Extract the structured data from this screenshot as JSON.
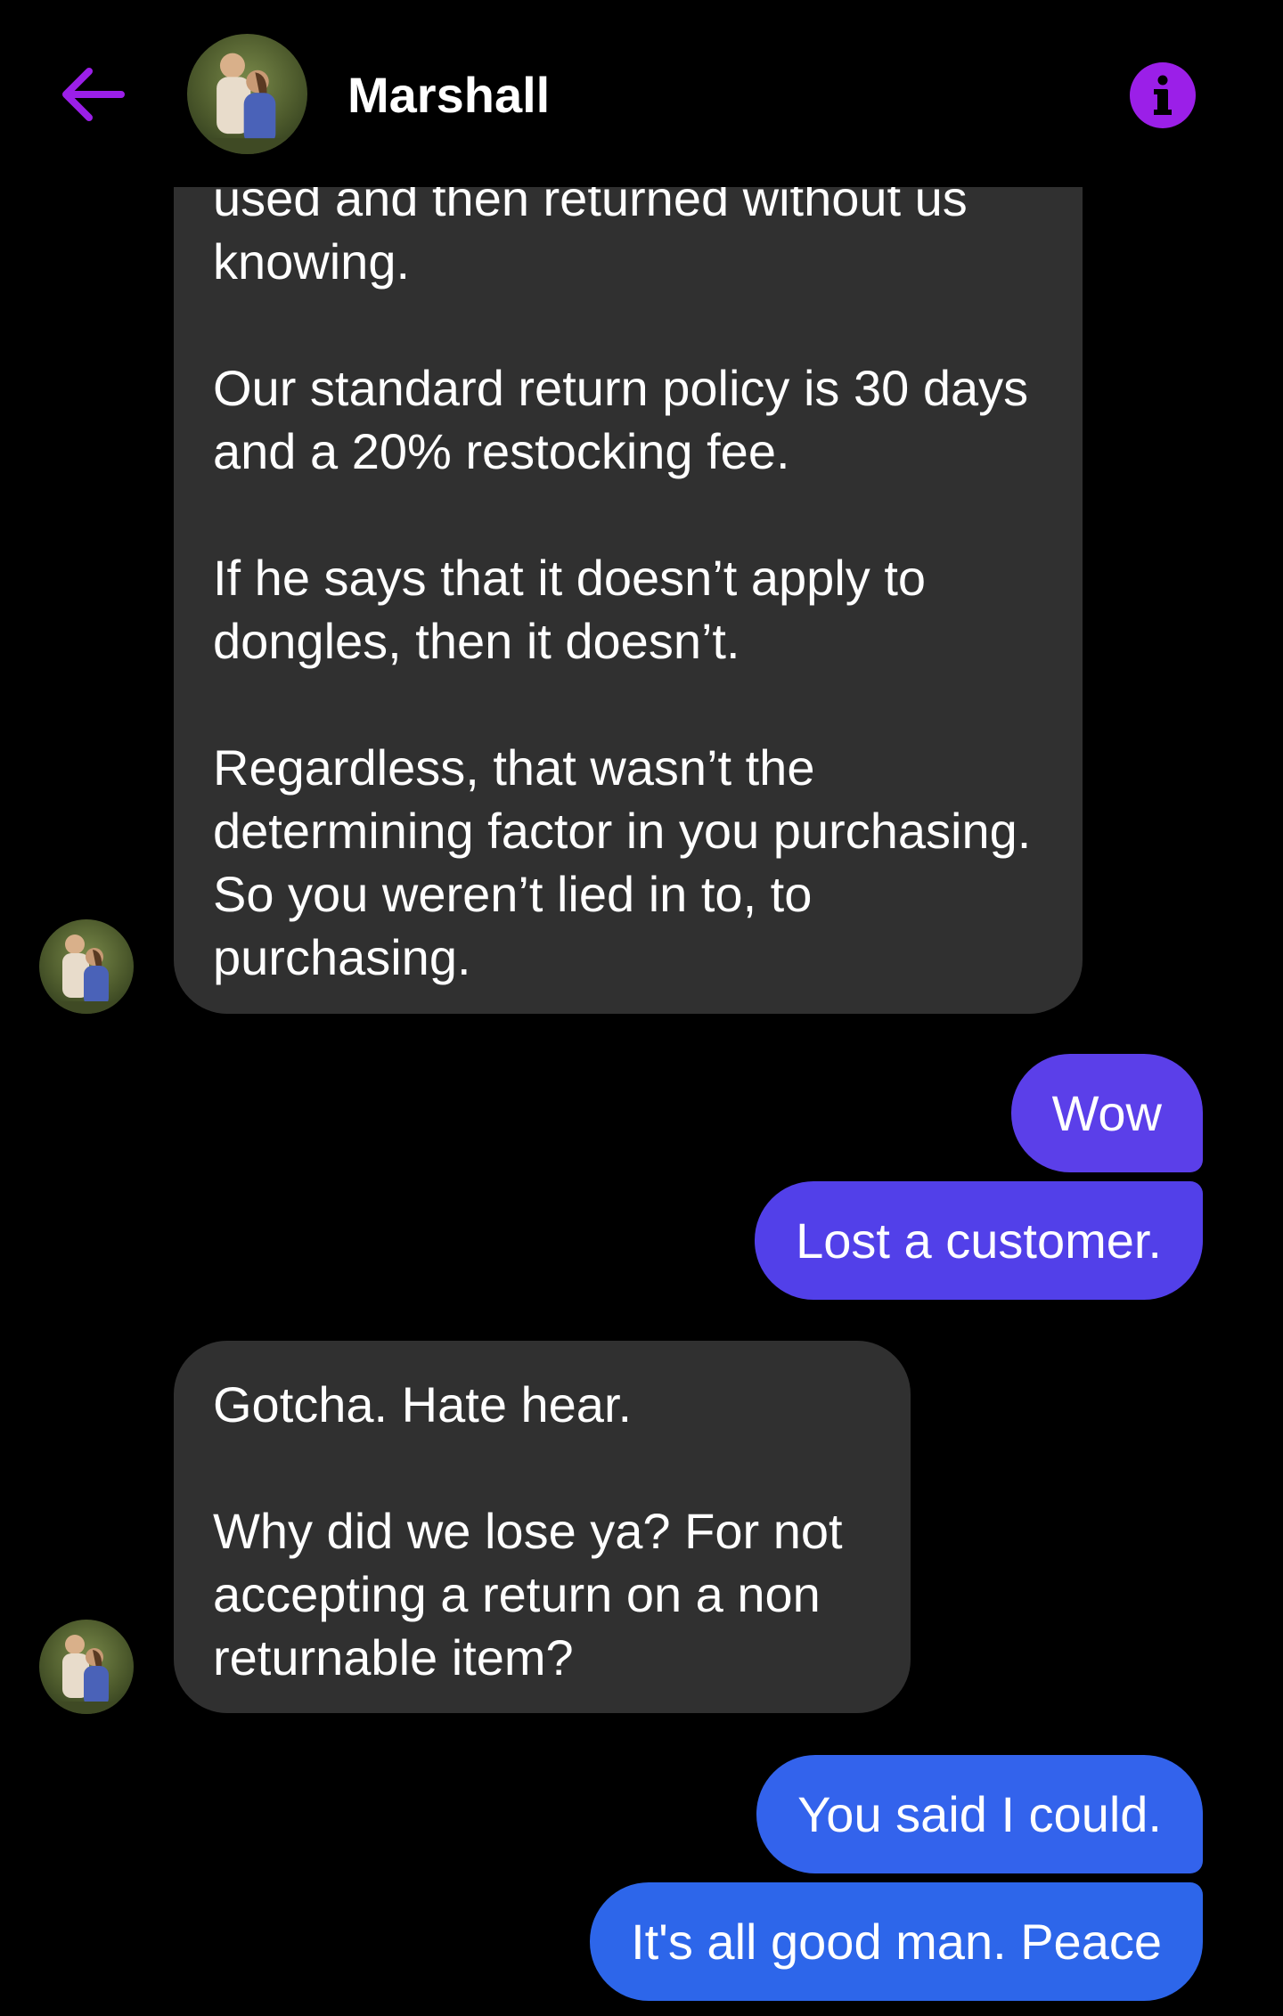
{
  "header": {
    "contact_name": "Marshall",
    "back_icon": "arrow-left-icon",
    "info_icon": "info-icon"
  },
  "messages": [
    {
      "direction": "incoming",
      "text": "used and then returned without us knowing.\n\nOur standard return policy is 30 days and a 20% restocking fee.\n\nIf he says that it doesn’t apply to dongles, then it doesn’t.\n\nRegardless, that wasn’t the determining factor in you purchasing. So you weren’t lied in to, to purchasing."
    },
    {
      "direction": "outgoing",
      "text": "Wow"
    },
    {
      "direction": "outgoing",
      "text": "Lost a customer."
    },
    {
      "direction": "incoming",
      "text": "Gotcha. Hate hear.\n\nWhy did we lose ya? For not accepting a return on a non returnable item?"
    },
    {
      "direction": "outgoing",
      "text": "You said I could."
    },
    {
      "direction": "outgoing",
      "text": "It's all good man. Peace"
    }
  ],
  "colors": {
    "background": "#000000",
    "incoming_bubble": "#303030",
    "outgoing_purple": "#6a3cf0",
    "outgoing_blue": "#2f63ea",
    "accent": "#9b1fe8"
  }
}
